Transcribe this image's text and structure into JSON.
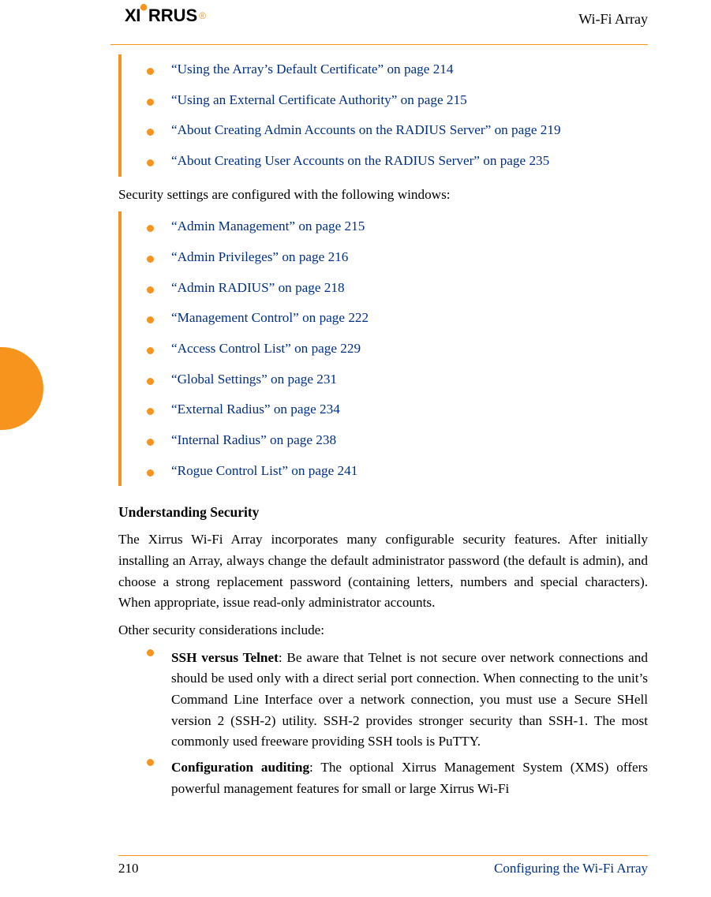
{
  "header": {
    "logo_text": "XIRRUS",
    "right_text": "Wi-Fi Array"
  },
  "list_a": [
    "“Using the Array’s Default Certificate” on page 214",
    "“Using an External Certificate Authority” on page 215",
    "“About Creating Admin Accounts on the RADIUS Server” on page 219",
    "“About Creating User Accounts on the RADIUS Server” on page 235"
  ],
  "intro_line": "Security settings are configured with the following windows:",
  "list_b": [
    "“Admin Management” on page 215",
    "“Admin Privileges” on page 216",
    "“Admin RADIUS” on page 218",
    "“Management Control” on page 222",
    "“Access Control List” on page 229",
    "“Global Settings” on page 231",
    "“External Radius” on page 234",
    "“Internal Radius” on page 238",
    "“Rogue Control List” on page 241"
  ],
  "heading": "Understanding Security",
  "para1": "The Xirrus Wi-Fi Array incorporates many configurable security features. After initially installing an Array, always change the default administrator password (the default is admin), and choose a strong replacement password (containing letters, numbers and special characters). When appropriate, issue read-only administrator accounts.",
  "para2": "Other security considerations include:",
  "items": [
    {
      "bold": "SSH versus Telnet",
      "text": ": Be aware that Telnet is not secure over network connections and should be used only with a direct serial port connection. When connecting to the unit’s Command Line Interface over a network connection, you must use a Secure SHell version 2 (SSH-2) utility. SSH-2 provides stronger security than SSH-1. The most commonly used freeware providing SSH tools is PuTTY."
    },
    {
      "bold": "Configuration auditing",
      "text": ": The optional Xirrus Management System (XMS) offers powerful management features for small or large Xirrus Wi-Fi"
    }
  ],
  "footer": {
    "page": "210",
    "section": "Configuring the Wi-Fi Array"
  }
}
